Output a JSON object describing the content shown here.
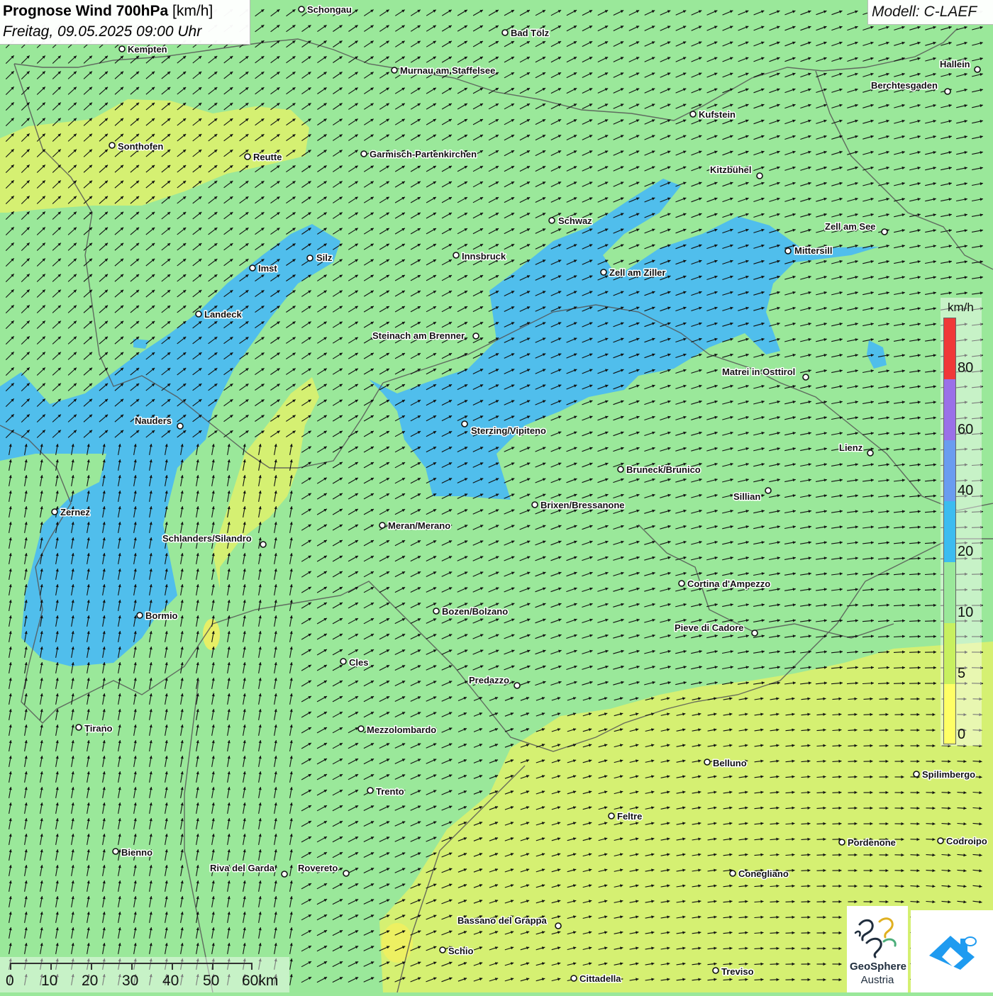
{
  "header": {
    "title_bold": "Prognose Wind 700hPa",
    "title_unit": "[km/h]",
    "subtitle": "Freitag, 09.05.2025 09:00 Uhr"
  },
  "model": {
    "label": "Modell: C-LAEF"
  },
  "legend": {
    "unit": "km/h",
    "ticks": [
      "0",
      "5",
      "10",
      "20",
      "40",
      "60",
      "80"
    ],
    "colors": [
      "#ffff66",
      "#c8f060",
      "#9ae89a",
      "#3cbcf0",
      "#6a9cf0",
      "#9a70e8",
      "#f03838"
    ]
  },
  "map_colors": {
    "base": "#9ae89a",
    "strong": "#4cbcf0",
    "weak": "#d8f070",
    "calm": "#f0f060",
    "border": "#555555",
    "arrow": "#111111"
  },
  "cities": [
    {
      "name": "Schongau"
    },
    {
      "name": "Bad Tölz"
    },
    {
      "name": "Kempten"
    },
    {
      "name": "Murnau am Staffelsee"
    },
    {
      "name": "Hallein"
    },
    {
      "name": "Berchtesgaden"
    },
    {
      "name": "Kufstein"
    },
    {
      "name": "Sonthofen"
    },
    {
      "name": "Reutte"
    },
    {
      "name": "Garmisch-Partenkirchen"
    },
    {
      "name": "Kitzbühel"
    },
    {
      "name": "Schwaz"
    },
    {
      "name": "Zell am See"
    },
    {
      "name": "Silz"
    },
    {
      "name": "Innsbruck"
    },
    {
      "name": "Mittersill"
    },
    {
      "name": "Imst"
    },
    {
      "name": "Zell am Ziller"
    },
    {
      "name": "Landeck"
    },
    {
      "name": "Steinach am Brenner"
    },
    {
      "name": "Matrei in Osttirol"
    },
    {
      "name": "Nauders"
    },
    {
      "name": "Sterzing/Vipiteno"
    },
    {
      "name": "Lienz"
    },
    {
      "name": "Bruneck/Brunico"
    },
    {
      "name": "Sillian"
    },
    {
      "name": "Zernez"
    },
    {
      "name": "Brixen/Bressanone"
    },
    {
      "name": "Meran/Merano"
    },
    {
      "name": "Schlanders/Silandro"
    },
    {
      "name": "Cortina d'Ampezzo"
    },
    {
      "name": "Bormio"
    },
    {
      "name": "Bozen/Bolzano"
    },
    {
      "name": "Pieve di Cadore"
    },
    {
      "name": "Cles"
    },
    {
      "name": "Predazzo"
    },
    {
      "name": "Tirano"
    },
    {
      "name": "Mezzolombardo"
    },
    {
      "name": "Belluno"
    },
    {
      "name": "Spilimbergo"
    },
    {
      "name": "Trento"
    },
    {
      "name": "Feltre"
    },
    {
      "name": "Bienno"
    },
    {
      "name": "Pordenone"
    },
    {
      "name": "Codroipo"
    },
    {
      "name": "Riva del Garda"
    },
    {
      "name": "Rovereto"
    },
    {
      "name": "Conegliano"
    },
    {
      "name": "Bassano del Grappa"
    },
    {
      "name": "Schio"
    },
    {
      "name": "Treviso"
    },
    {
      "name": "Cittadella"
    }
  ],
  "scale": {
    "labels": [
      "0",
      "10",
      "20",
      "30",
      "40",
      "50",
      "60km"
    ]
  },
  "logo": {
    "line1": "GeoSphere",
    "line2": "Austria"
  }
}
